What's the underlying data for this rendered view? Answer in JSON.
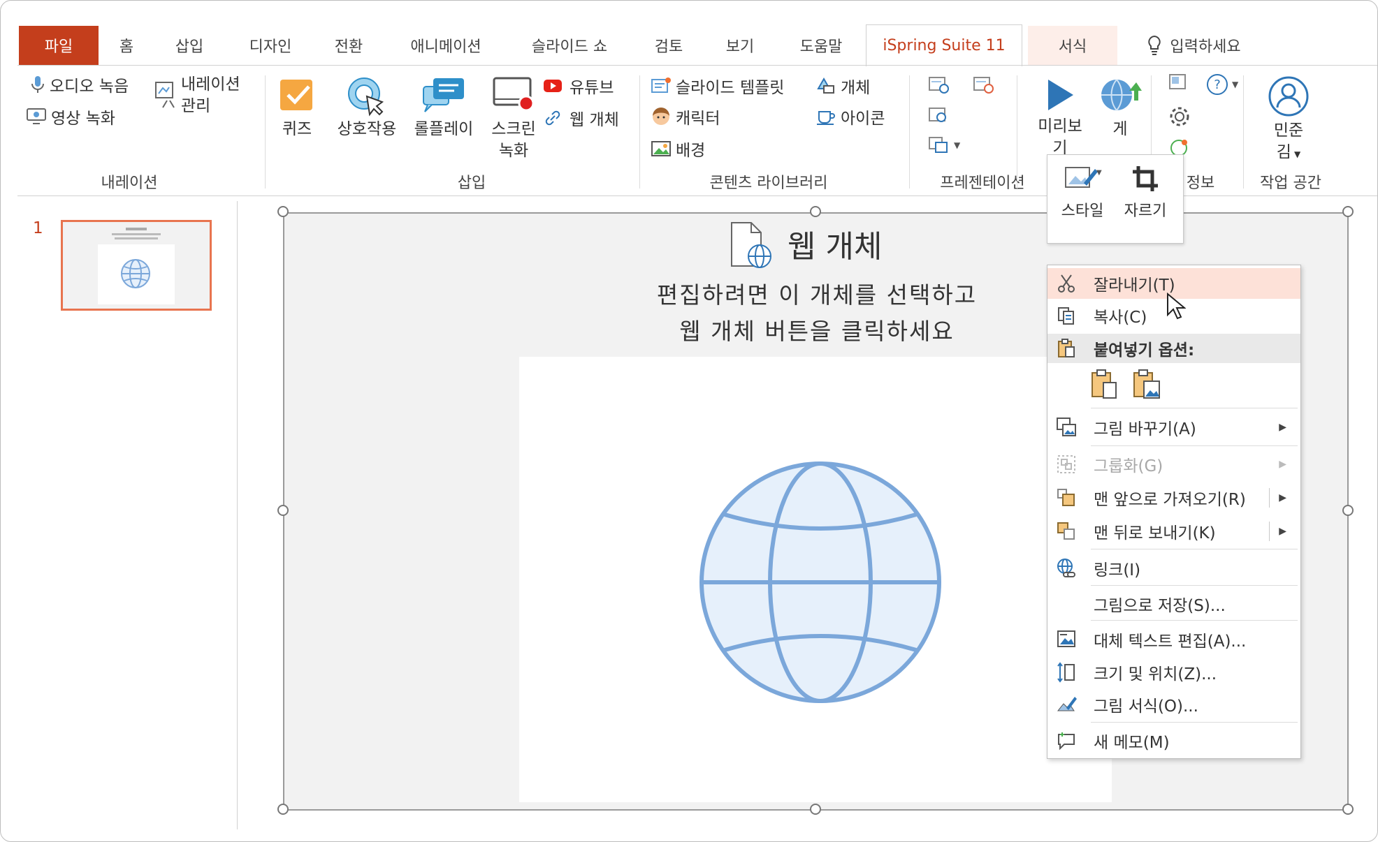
{
  "tabs": [
    {
      "label": "파일"
    },
    {
      "label": "홈"
    },
    {
      "label": "삽입"
    },
    {
      "label": "디자인"
    },
    {
      "label": "전환"
    },
    {
      "label": "애니메이션"
    },
    {
      "label": "슬라이드 쇼"
    },
    {
      "label": "검토"
    },
    {
      "label": "보기"
    },
    {
      "label": "도움말"
    },
    {
      "label": "iSpring Suite 11"
    },
    {
      "label": "서식"
    }
  ],
  "search": {
    "label": "입력하세요"
  },
  "ribbon": {
    "narration": {
      "audio": "오디오 녹음",
      "video": "영상 녹화",
      "manage_line1": "내레이션",
      "manage_line2": "관리",
      "group": "내레이션"
    },
    "insert": {
      "quiz": "퀴즈",
      "interaction": "상호작용",
      "roleplay": "롤플레이",
      "screen_line1": "스크린",
      "screen_line2": "녹화",
      "youtube": "유튜브",
      "webobject": "웹 개체",
      "group": "삽입"
    },
    "content": {
      "template": "슬라이드 템플릿",
      "object": "개체",
      "character": "캐릭터",
      "icon": "아이콘",
      "background": "배경",
      "group": "콘텐츠 라이브러리"
    },
    "presentation": {
      "group": "프레젠테이션"
    },
    "publish": {
      "preview_line1": "미리보",
      "preview_line2": "기",
      "publish_label": "게",
      "info_group": "정보"
    },
    "workspace": {
      "user_line1": "민준",
      "user_line2": "김",
      "group": "작업 공간"
    }
  },
  "slide_panel": {
    "number": "1"
  },
  "slide": {
    "title": "웹 개체",
    "desc_line1": "편집하려면 이 개체를 선택하고",
    "desc_line2": "웹 개체 버튼을 클릭하세요"
  },
  "mini_toolbar": {
    "style": "스타일",
    "crop": "자르기"
  },
  "context_menu": {
    "cut": "잘라내기(T)",
    "copy": "복사(C)",
    "paste_options": "붙여넣기 옵션:",
    "change_picture": "그림 바꾸기(A)",
    "group": "그룹화(G)",
    "bring_front": "맨 앞으로 가져오기(R)",
    "send_back": "맨 뒤로 보내기(K)",
    "link": "링크(I)",
    "save_picture": "그림으로 저장(S)...",
    "alt_text": "대체 텍스트 편집(A)...",
    "size_position": "크기 및 위치(Z)...",
    "format_picture": "그림 서식(O)...",
    "new_comment": "새 메모(M)"
  },
  "colors": {
    "file_tab": "#c43e1c",
    "accent_blue": "#2e75b6",
    "globe": "#7ba7da",
    "highlight": "#fde1d8"
  }
}
